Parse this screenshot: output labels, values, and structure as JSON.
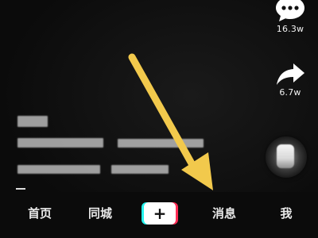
{
  "rail": {
    "comment_count": "16.3w",
    "share_count": "6.7w",
    "comment_icon": "comment-bubble-icon",
    "share_icon": "share-arrow-icon",
    "music_disc_icon": "music-disc-icon"
  },
  "tabbar": {
    "home_label": "首页",
    "city_label": "同城",
    "create_label": "+",
    "messages_label": "消息",
    "me_label": "我"
  },
  "overlay": {
    "arrow_color": "#f2c94c",
    "arrow_icon": "pointer-arrow-icon"
  },
  "colors": {
    "background": "#0b0b0b",
    "accent_cyan": "#25f4ee",
    "accent_pink": "#fe2c55"
  }
}
